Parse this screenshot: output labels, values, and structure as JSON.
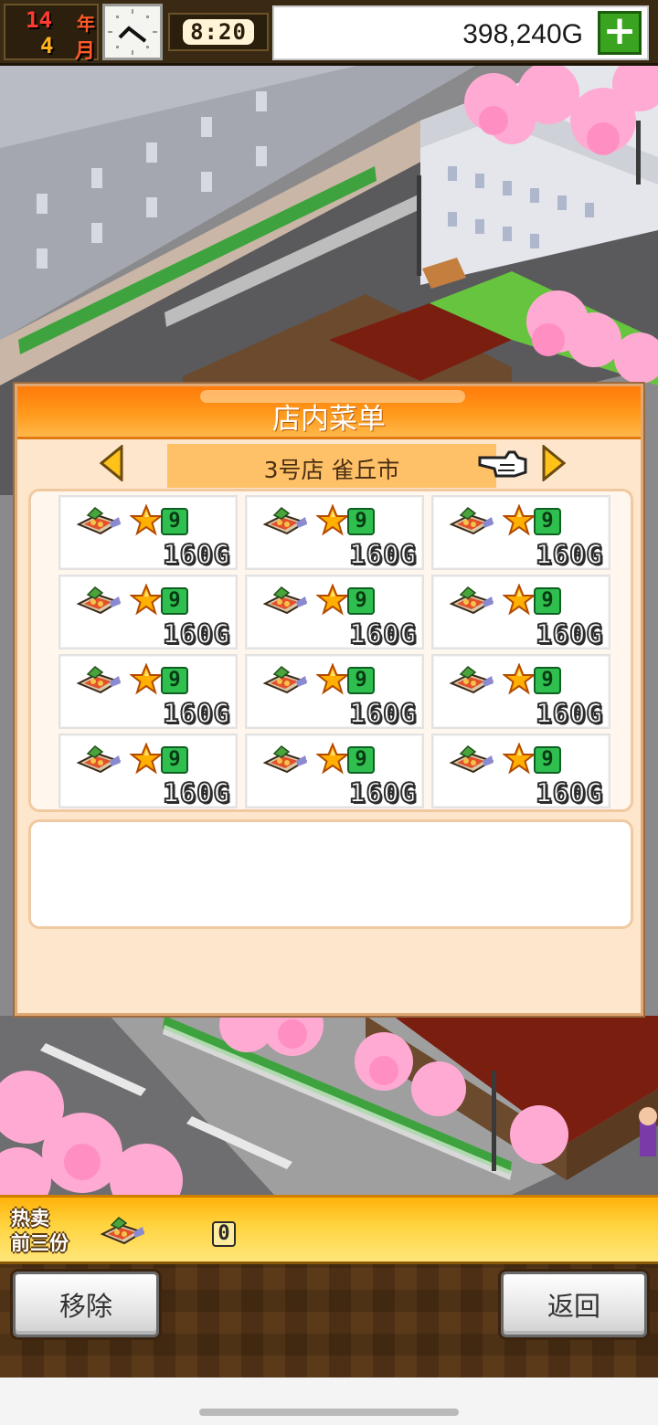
{
  "status_bar": {
    "year": "14",
    "year_unit": "年",
    "month": "4",
    "month_unit": "月",
    "time": "8:20",
    "money": "398,240G",
    "add_money_symbol": "+"
  },
  "dialog": {
    "title": "店内菜单",
    "shop_name": "3号店 雀丘市",
    "items": [
      {
        "level": "9",
        "price": "160G"
      },
      {
        "level": "9",
        "price": "160G"
      },
      {
        "level": "9",
        "price": "160G"
      },
      {
        "level": "9",
        "price": "160G"
      },
      {
        "level": "9",
        "price": "160G"
      },
      {
        "level": "9",
        "price": "160G"
      },
      {
        "level": "9",
        "price": "160G"
      },
      {
        "level": "9",
        "price": "160G"
      },
      {
        "level": "9",
        "price": "160G"
      },
      {
        "level": "9",
        "price": "160G"
      },
      {
        "level": "9",
        "price": "160G"
      },
      {
        "level": "9",
        "price": "160G"
      }
    ],
    "description": ""
  },
  "best_sellers": {
    "label_line1": "热卖",
    "label_line2": "前三份",
    "count": "0"
  },
  "buttons": {
    "remove": "移除",
    "back": "返回"
  },
  "icons": {
    "dish": "curry-dish-icon",
    "star": "star-icon",
    "prev": "arrow-left-icon",
    "next": "arrow-right-icon",
    "pointer": "hand-pointer-icon",
    "clock": "clock-icon"
  },
  "colors": {
    "header_orange": "#ff8a14",
    "dialog_bg": "#fde6cc",
    "level_green": "#2fbf4f",
    "money_plus_green": "#3aa320"
  }
}
